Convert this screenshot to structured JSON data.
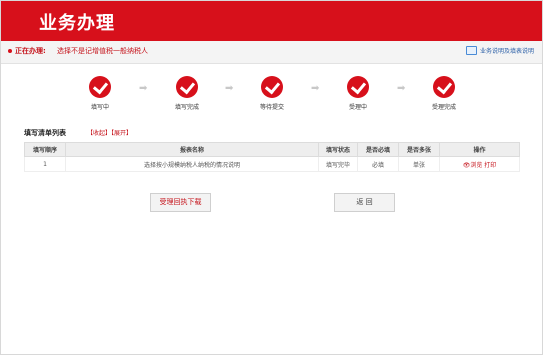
{
  "header": {
    "title": "业务办理"
  },
  "status": {
    "label": "正在办理:",
    "value": "选择不是记增值税一般纳税人",
    "help_link": "业务说明及填表说明"
  },
  "steps": [
    {
      "label": "填写中"
    },
    {
      "label": "填写完成"
    },
    {
      "label": "等待提交"
    },
    {
      "label": "受理中"
    },
    {
      "label": "受理完成"
    }
  ],
  "arrow_glyph": "➡",
  "list": {
    "title": "填写清单列表",
    "actions": "【收起】【展开】"
  },
  "table": {
    "headers": [
      "填写顺序",
      "报表名称",
      "填写状态",
      "是否必填",
      "是否多张",
      "操作"
    ],
    "rows": [
      {
        "order": "1",
        "name": "选择按小规模纳税人纳税的情况说明",
        "status": "填写完毕",
        "required": "必填",
        "multiple": "单张",
        "ops": "浏览 打印"
      }
    ]
  },
  "buttons": {
    "download": "受理回执下载",
    "back": "返 回"
  }
}
